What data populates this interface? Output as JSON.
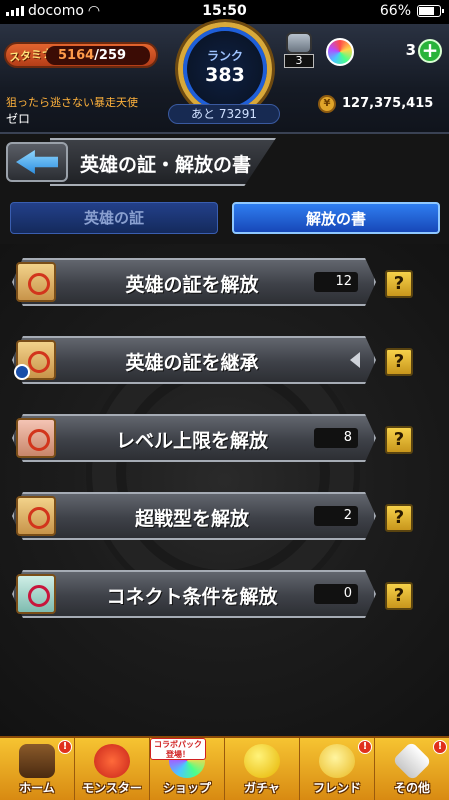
{
  "status_bar": {
    "carrier": "docomo",
    "time": "15:50",
    "battery": "66%"
  },
  "hud": {
    "stamina_label": "スタミナ",
    "stamina_current": "5164",
    "stamina_max": "/259",
    "rank_label": "ランク",
    "rank_value": "383",
    "next_rank": "あと 73291",
    "chest_count": "3",
    "orb_count": "3",
    "quest_name": "狙ったら逃さない暴走天使",
    "player_name": "ゼロ",
    "gold": "127,375,415"
  },
  "title": {
    "text": "英雄の証・解放の書"
  },
  "tabs": [
    {
      "label": "英雄の証",
      "active": false
    },
    {
      "label": "解放の書",
      "active": true
    }
  ],
  "items": [
    {
      "label": "英雄の証を解放",
      "count": "12",
      "help": "?"
    },
    {
      "label": "英雄の証を継承",
      "count": null,
      "help": "?"
    },
    {
      "label": "レベル上限を解放",
      "count": "8",
      "help": "?"
    },
    {
      "label": "超戦型を解放",
      "count": "2",
      "help": "?"
    },
    {
      "label": "コネクト条件を解放",
      "count": "0",
      "help": "?"
    }
  ],
  "nav": {
    "items": [
      {
        "label": "ホーム"
      },
      {
        "label": "モンスター"
      },
      {
        "label": "ショップ"
      },
      {
        "label": "ガチャ"
      },
      {
        "label": "フレンド"
      },
      {
        "label": "その他"
      }
    ],
    "collab_badge": "コラボパック\n登場！",
    "alert": "!"
  }
}
